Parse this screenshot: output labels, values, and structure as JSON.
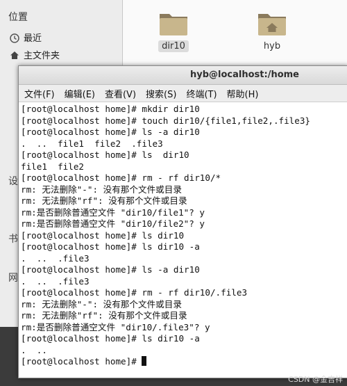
{
  "file_manager": {
    "section_title": "位置",
    "items": [
      {
        "label": "最近"
      },
      {
        "label": "主文件夹"
      }
    ],
    "partial_letters": [
      "设",
      "书",
      "网"
    ],
    "folders": [
      {
        "name": "dir10",
        "selected": true
      },
      {
        "name": "hyb",
        "selected": false
      }
    ]
  },
  "terminal": {
    "title": "hyb@localhost:/home",
    "menus": [
      "文件(F)",
      "编辑(E)",
      "查看(V)",
      "搜索(S)",
      "终端(T)",
      "帮助(H)"
    ],
    "lines": [
      "[root@localhost home]# mkdir dir10",
      "[root@localhost home]# touch dir10/{file1,file2,.file3}",
      "[root@localhost home]# ls -a dir10",
      ".  ..  file1  file2  .file3",
      "[root@localhost home]# ls  dir10",
      "file1  file2",
      "[root@localhost home]# rm - rf dir10/*",
      "rm: 无法删除\"-\": 没有那个文件或目录",
      "rm: 无法删除\"rf\": 没有那个文件或目录",
      "rm:是否删除普通空文件 \"dir10/file1\"? y",
      "rm:是否删除普通空文件 \"dir10/file2\"? y",
      "[root@localhost home]# ls dir10",
      "[root@localhost home]# ls dir10 -a",
      ".  ..  .file3",
      "[root@localhost home]# ls -a dir10",
      ".  ..  .file3",
      "[root@localhost home]# rm - rf dir10/.file3",
      "rm: 无法删除\"-\": 没有那个文件或目录",
      "rm: 无法删除\"rf\": 没有那个文件或目录",
      "rm:是否删除普通空文件 \"dir10/.file3\"? y",
      "[root@localhost home]# ls dir10 -a",
      ".  ..",
      "[root@localhost home]# "
    ]
  },
  "watermark": "CSDN @金吉祥"
}
